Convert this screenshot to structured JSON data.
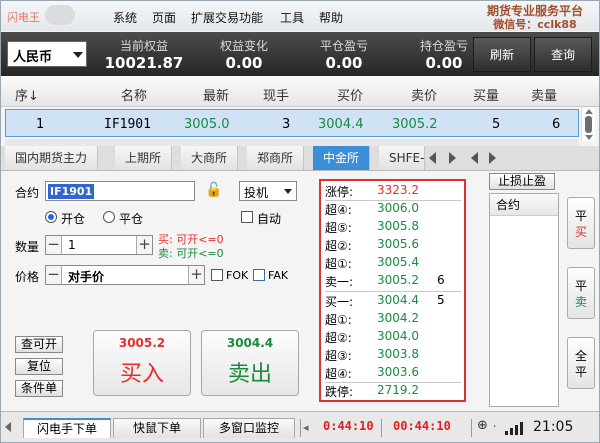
{
  "titlebar": {
    "app_name": "闪电王",
    "menus": [
      "系统",
      "页面",
      "扩展交易功能",
      "工具",
      "帮助"
    ],
    "service_line1": "期货专业服务平台",
    "service_line2": "微信号：cclk88"
  },
  "summary": {
    "currency": "人民币",
    "items": [
      {
        "label": "当前权益",
        "value": "10021.87"
      },
      {
        "label": "权益变化",
        "value": "0.00"
      },
      {
        "label": "平仓盈亏",
        "value": "0.00"
      },
      {
        "label": "持仓盈亏",
        "value": "0.00"
      }
    ],
    "refresh_label": "刷新",
    "query_label": "查询"
  },
  "table": {
    "headers": [
      "序",
      "名称",
      "最新",
      "现手",
      "买价",
      "卖价",
      "买量",
      "卖量"
    ],
    "sort_arrow": "↓",
    "row": {
      "seq": "1",
      "name": "IF1901",
      "last": "3005.0",
      "lot": "3",
      "bid": "3004.4",
      "ask": "3005.2",
      "bid_vol": "5",
      "ask_vol": "6"
    }
  },
  "exchanges": {
    "tabs": [
      "国内期货主力",
      "上期所",
      "大商所",
      "郑商所",
      "中金所",
      "SHFE-"
    ],
    "active": "中金所"
  },
  "order": {
    "contract_label": "合约",
    "contract_value": "IF1901",
    "hedge_value": "投机",
    "open_label": "开仓",
    "close_label": "平仓",
    "auto_label": "自动",
    "qty_label": "数量",
    "qty_value": "1",
    "buy_hint": "买: 可开<=0",
    "sell_hint": "卖: 可开<=0",
    "price_label": "价格",
    "price_value": "对手价",
    "fok_label": "FOK",
    "fak_label": "FAK",
    "query_open_label": "查可开",
    "copy_label": "复位",
    "condition_label": "条件单",
    "buy_price": "3005.2",
    "buy_label": "买入",
    "sell_price": "3004.4",
    "sell_label": "卖出"
  },
  "depth": {
    "limit_up": {
      "name": "涨停:",
      "price": "3323.2"
    },
    "asks": [
      {
        "name": "超④:",
        "price": "3006.0",
        "vol": ""
      },
      {
        "name": "超⑤:",
        "price": "3005.8",
        "vol": ""
      },
      {
        "name": "超②:",
        "price": "3005.6",
        "vol": ""
      },
      {
        "name": "超①:",
        "price": "3005.4",
        "vol": ""
      },
      {
        "name": "卖一:",
        "price": "3005.2",
        "vol": "6"
      }
    ],
    "bids": [
      {
        "name": "买一:",
        "price": "3004.4",
        "vol": "5"
      },
      {
        "name": "超①:",
        "price": "3004.2",
        "vol": ""
      },
      {
        "name": "超②:",
        "price": "3004.0",
        "vol": ""
      },
      {
        "name": "超③:",
        "price": "3003.8",
        "vol": ""
      },
      {
        "name": "超④:",
        "price": "3003.6",
        "vol": ""
      }
    ],
    "limit_down": {
      "name": "跌停:",
      "price": "2719.2"
    }
  },
  "stop": {
    "button_label": "止损止盈",
    "header": "合约",
    "side_buttons": [
      {
        "top": "平",
        "bottom": "买"
      },
      {
        "top": "平",
        "bottom": "卖"
      },
      {
        "top": "全",
        "bottom": "平"
      }
    ]
  },
  "bottom": {
    "tabs": [
      "闪电手下单",
      "快鼠下单",
      "多窗口监控"
    ],
    "time1": "0:44:10",
    "time2": "00:44:10",
    "clock": "21:05"
  },
  "colors": {
    "up": "#e03030",
    "down": "#1c8a3e",
    "accent": "#3a8fd8"
  }
}
